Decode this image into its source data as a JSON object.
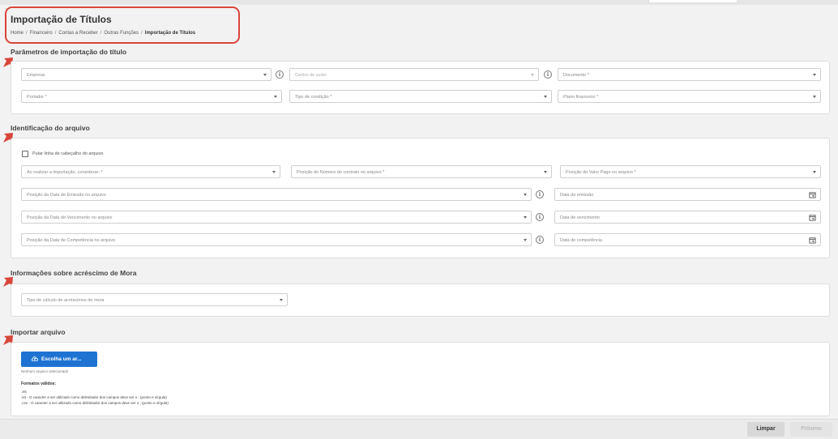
{
  "header": {
    "title": "Importação de Títulos",
    "breadcrumb": [
      "Home",
      "Financeiro",
      "Contas a Receber",
      "Outras Funções",
      "Importação de Títulos"
    ],
    "separator": "/"
  },
  "sections": {
    "params": {
      "title": "Parâmetros de importação do título",
      "empresa": "Empresa",
      "centro_custo": "Centro de custo",
      "documento": "Documento *",
      "portador": "Portador *",
      "tipo_condicao": "Tipo de condição *",
      "plano_financeiro": "Plano financeiro *"
    },
    "file_id": {
      "title": "Identificação do arquivo",
      "skip_header": "Pular linha de cabeçalho do arquivo",
      "consider": "Ao realizar a importação, considerar: *",
      "contract_pos": "Posição do Número do contrato no arquivo *",
      "paid_pos": "Posição do Valor Pago no arquivo *",
      "emission_pos": "Posição da Data de Emissão no arquivo",
      "emission_date": "Data de emissão",
      "due_pos": "Posição da Data de Vencimento no arquivo",
      "due_date": "Data de vencimento",
      "competence_pos": "Posição da Data de Competência no arquivo",
      "competence_date": "Data de competência"
    },
    "mora": {
      "title": "Informações sobre acréscimo de Mora",
      "calc_type": "Tipo de cálculo de acréscimos de mora"
    },
    "import": {
      "title": "Importar arquivo",
      "choose_button": "Escolha um ar...",
      "no_file": "Nenhum arquivo selecionado",
      "formats_title": "Formatos válidos:",
      "formats": [
        ".xls",
        ".txt - O caracter a ser utilizado como delimitador dos campos deve ser o ; (ponto e vírgula)",
        ".csv - O caracter a ser utilizado como delimitador dos campos deve ser o ; (ponto e vírgula)"
      ]
    }
  },
  "footer": {
    "clear": "Limpar",
    "next": "Próximo"
  },
  "colors": {
    "accent": "#1e73d2",
    "annotation": "#d9453a"
  }
}
